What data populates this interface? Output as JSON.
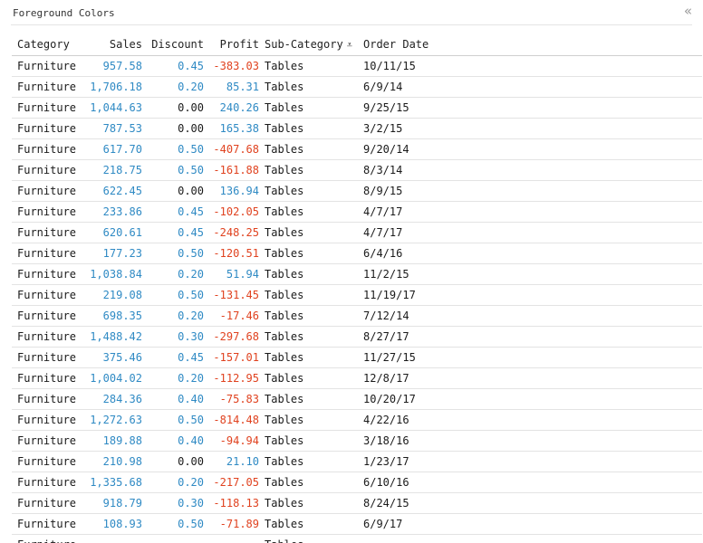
{
  "panel": {
    "title": "Foreground Colors",
    "collapse_icon": "«"
  },
  "colors": {
    "positive": "#2f8ac4",
    "negative": "#e0421f",
    "zero": "#1a1a1a"
  },
  "table": {
    "columns": [
      "Category",
      "Sales",
      "Discount",
      "Profit",
      "Sub-Category",
      "Order Date"
    ],
    "sort_icon": "⩡",
    "rows": [
      [
        "Furniture",
        "957.58",
        "0.45",
        "-383.03",
        "Tables",
        "10/11/15"
      ],
      [
        "Furniture",
        "1,706.18",
        "0.20",
        "85.31",
        "Tables",
        "6/9/14"
      ],
      [
        "Furniture",
        "1,044.63",
        "0.00",
        "240.26",
        "Tables",
        "9/25/15"
      ],
      [
        "Furniture",
        "787.53",
        "0.00",
        "165.38",
        "Tables",
        "3/2/15"
      ],
      [
        "Furniture",
        "617.70",
        "0.50",
        "-407.68",
        "Tables",
        "9/20/14"
      ],
      [
        "Furniture",
        "218.75",
        "0.50",
        "-161.88",
        "Tables",
        "8/3/14"
      ],
      [
        "Furniture",
        "622.45",
        "0.00",
        "136.94",
        "Tables",
        "8/9/15"
      ],
      [
        "Furniture",
        "233.86",
        "0.45",
        "-102.05",
        "Tables",
        "4/7/17"
      ],
      [
        "Furniture",
        "620.61",
        "0.45",
        "-248.25",
        "Tables",
        "4/7/17"
      ],
      [
        "Furniture",
        "177.23",
        "0.50",
        "-120.51",
        "Tables",
        "6/4/16"
      ],
      [
        "Furniture",
        "1,038.84",
        "0.20",
        "51.94",
        "Tables",
        "11/2/15"
      ],
      [
        "Furniture",
        "219.08",
        "0.50",
        "-131.45",
        "Tables",
        "11/19/17"
      ],
      [
        "Furniture",
        "698.35",
        "0.20",
        "-17.46",
        "Tables",
        "7/12/14"
      ],
      [
        "Furniture",
        "1,488.42",
        "0.30",
        "-297.68",
        "Tables",
        "8/27/17"
      ],
      [
        "Furniture",
        "375.46",
        "0.45",
        "-157.01",
        "Tables",
        "11/27/15"
      ],
      [
        "Furniture",
        "1,004.02",
        "0.20",
        "-112.95",
        "Tables",
        "12/8/17"
      ],
      [
        "Furniture",
        "284.36",
        "0.40",
        "-75.83",
        "Tables",
        "10/20/17"
      ],
      [
        "Furniture",
        "1,272.63",
        "0.50",
        "-814.48",
        "Tables",
        "4/22/16"
      ],
      [
        "Furniture",
        "189.88",
        "0.40",
        "-94.94",
        "Tables",
        "3/18/16"
      ],
      [
        "Furniture",
        "210.98",
        "0.00",
        "21.10",
        "Tables",
        "1/23/17"
      ],
      [
        "Furniture",
        "1,335.68",
        "0.20",
        "-217.05",
        "Tables",
        "6/10/16"
      ],
      [
        "Furniture",
        "918.79",
        "0.30",
        "-118.13",
        "Tables",
        "8/24/15"
      ],
      [
        "Furniture",
        "108.93",
        "0.50",
        "-71.89",
        "Tables",
        "6/9/17"
      ],
      [
        "Furniture",
        "",
        "",
        "",
        "Tables",
        ""
      ]
    ]
  }
}
